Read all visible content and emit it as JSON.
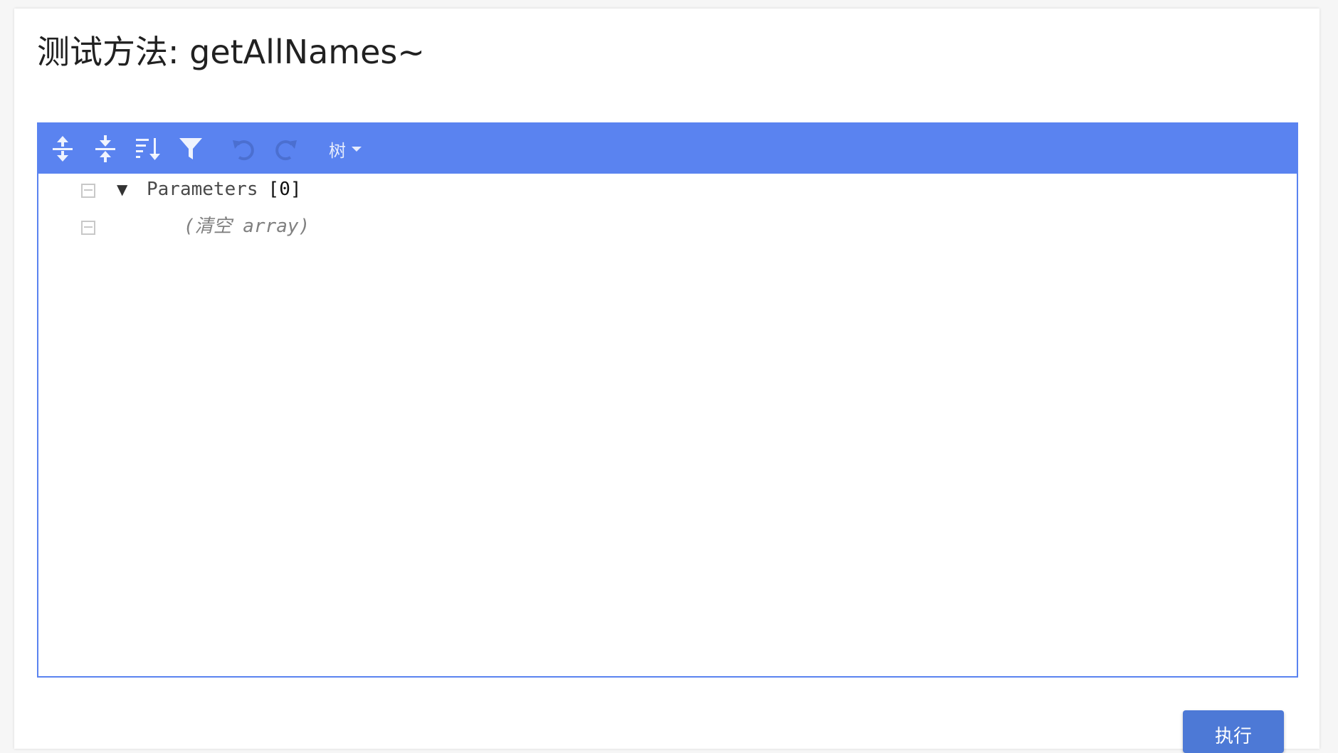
{
  "page": {
    "title": "测试方法: getAllNames~"
  },
  "toolbar": {
    "buttons": [
      {
        "name": "expand-all",
        "icon": "expand-all-icon"
      },
      {
        "name": "collapse-all",
        "icon": "collapse-all-icon"
      },
      {
        "name": "sort",
        "icon": "sort-icon"
      },
      {
        "name": "filter",
        "icon": "filter-icon"
      },
      {
        "name": "undo",
        "icon": "undo-icon",
        "disabled": true
      },
      {
        "name": "redo",
        "icon": "redo-icon",
        "disabled": true
      }
    ],
    "mode_label": "树"
  },
  "tree": {
    "root_field": "Parameters",
    "root_count": "[0]",
    "empty_label": "(清空 array)"
  },
  "actions": {
    "execute_label": "执行"
  },
  "colors": {
    "accent": "#5a83f0",
    "button": "#4d79d6"
  }
}
